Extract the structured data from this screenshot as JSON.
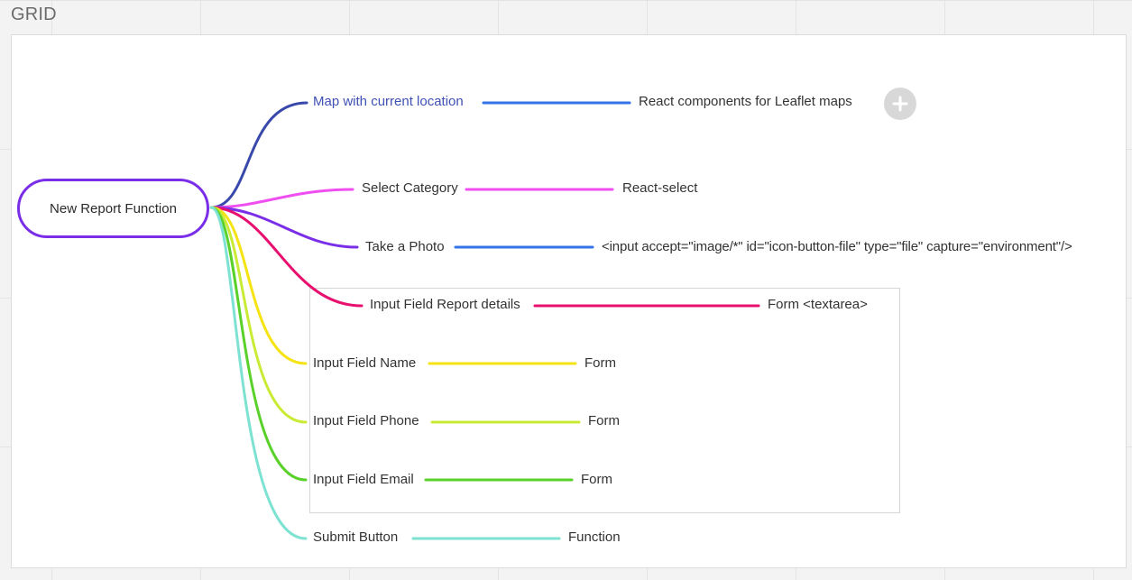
{
  "canvas": {
    "title": "GRID"
  },
  "mindmap": {
    "root": {
      "label": "New Report Function",
      "border_color": "#7a2ee8"
    },
    "branches": [
      {
        "label": "Map with current location",
        "label_color": "#3f51b5",
        "curve_color": "#3949ab",
        "line_color": "#3474e8",
        "child": "React components for Leaflet maps"
      },
      {
        "label": "Select Category",
        "curve_color": "#ef4ef0",
        "line_color": "#ef4ef0",
        "child": "React-select"
      },
      {
        "label": "Take a Photo",
        "curve_color": "#7a2ee8",
        "line_color": "#3474e8",
        "child": "<input accept=\"image/*\" id=\"icon-button-file\" type=\"file\" capture=\"environment\"/>"
      },
      {
        "label": "Input Field Report details",
        "curve_color": "#e8106e",
        "line_color": "#e8106e",
        "child": "Form <textarea>"
      },
      {
        "label": "Input Field Name",
        "curve_color": "#f5e313",
        "line_color": "#f5e313",
        "child": "Form"
      },
      {
        "label": "Input Field Phone",
        "curve_color": "#c9eb35",
        "line_color": "#c9eb35",
        "child": "Form"
      },
      {
        "label": "Input Field Email",
        "curve_color": "#5ad12a",
        "line_color": "#5ad12a",
        "child": "Form"
      },
      {
        "label": "Submit Button",
        "curve_color": "#7de2d1",
        "line_color": "#7de2d1",
        "child": "Function"
      }
    ]
  },
  "toolbar": {
    "add_icon": "plus-icon"
  }
}
